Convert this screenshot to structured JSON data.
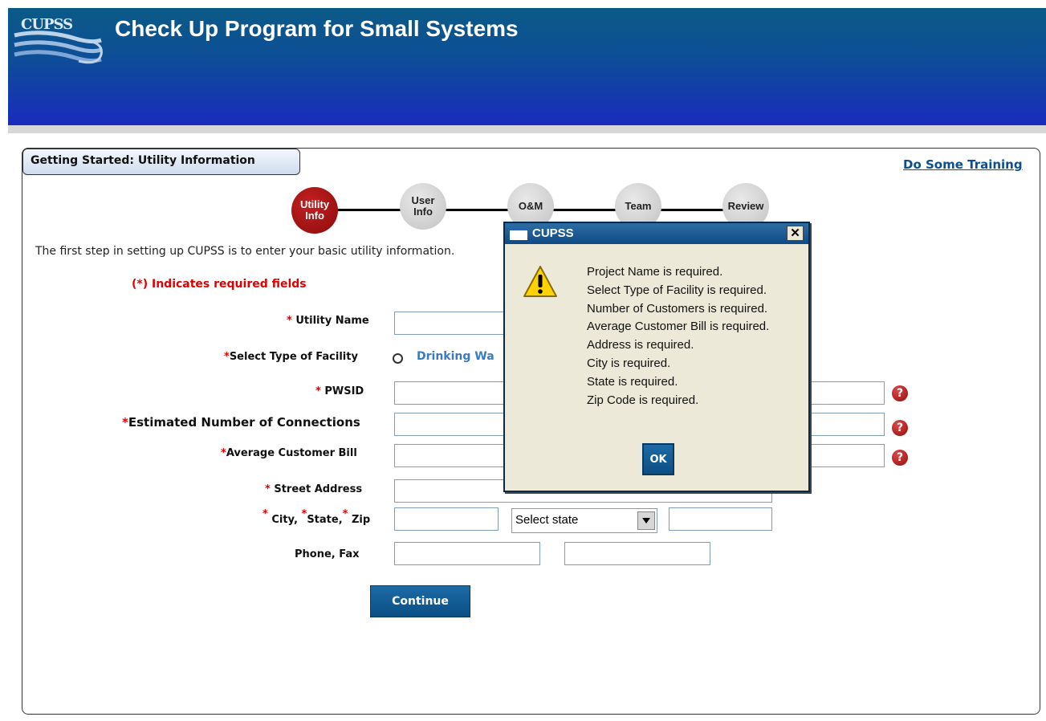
{
  "header": {
    "title": "Check Up Program for Small Systems",
    "logo_text": "CUPSS"
  },
  "panel": {
    "tab_title": "Getting Started: Utility Information",
    "training_link": "Do Some Training"
  },
  "steps": [
    {
      "label_line1": "Utility",
      "label_line2": "Info",
      "active": true
    },
    {
      "label_line1": "User",
      "label_line2": "Info",
      "active": false
    },
    {
      "label_line1": "O&M",
      "label_line2": "",
      "active": false
    },
    {
      "label_line1": "Team",
      "label_line2": "",
      "active": false
    },
    {
      "label_line1": "Review",
      "label_line2": "",
      "active": false
    }
  ],
  "intro_text": "The first step in setting up CUPSS is to enter your basic utility information.",
  "required_note": "(*) Indicates required fields",
  "form": {
    "utility_name_label": "Utility Name",
    "facility_type_label": "Select Type of Facility",
    "facility_option_1": "Drinking Wa",
    "pwsid_label": "PWSID",
    "connections_label": "Estimated Number of Connections",
    "bill_label": "Average Customer Bill",
    "street_label": "Street Address",
    "city_label": "City,",
    "state_label": "State,",
    "zip_label": "Zip",
    "phone_fax_label": "Phone, Fax",
    "state_select_value": "Select state",
    "continue_label": "Continue",
    "required_star": "*"
  },
  "dialog": {
    "title": "CUPSS",
    "close_glyph": "✕",
    "messages": [
      "Project Name is required.",
      "Select Type of Facility is required.",
      "Number of Customers is required.",
      "Average Customer Bill is required.",
      "Address is required.",
      "City is required.",
      "State is required.",
      "Zip Code is required."
    ],
    "ok_label": "OK"
  },
  "icons": {
    "help": "question-circle-icon",
    "warning": "warning-triangle-icon",
    "dropdown": "chevron-down-icon"
  },
  "colors": {
    "header_top": "#0b5a86",
    "header_bottom": "#1a2bbd",
    "required_red": "#e00000",
    "link_blue": "#0b4f90",
    "button_blue": "#0b4f84"
  }
}
